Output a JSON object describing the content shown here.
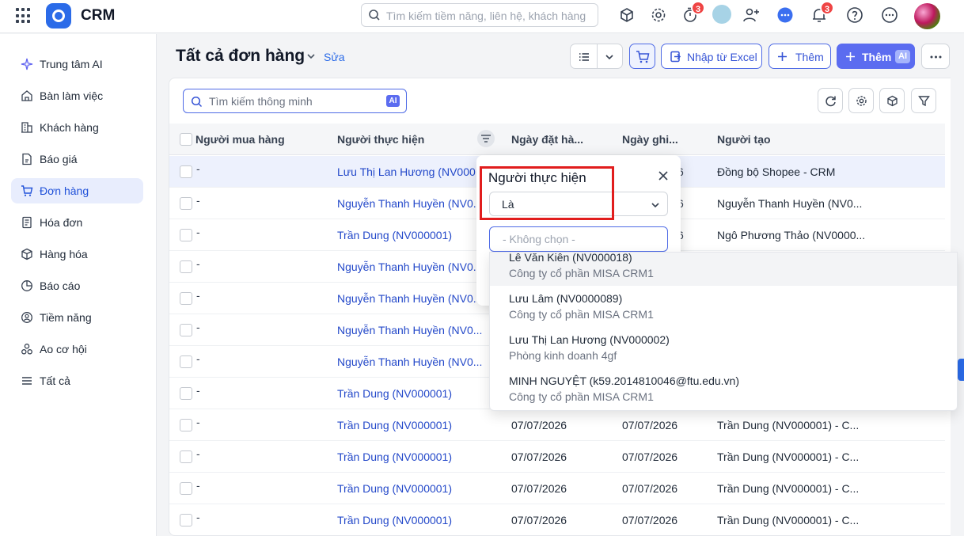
{
  "app": {
    "name": "CRM"
  },
  "topbar": {
    "search_placeholder": "Tìm kiếm tiềm năng, liên hệ, khách hàng",
    "timer_badge": "3",
    "notif_badge": "3"
  },
  "sidebar": {
    "items": [
      {
        "label": "Trung tâm AI",
        "icon": "sparkle-icon"
      },
      {
        "label": "Bàn làm việc",
        "icon": "home-icon"
      },
      {
        "label": "Khách hàng",
        "icon": "building-icon"
      },
      {
        "label": "Báo giá",
        "icon": "quote-doc-icon"
      },
      {
        "label": "Đơn hàng",
        "icon": "cart-icon",
        "active": true
      },
      {
        "label": "Hóa đơn",
        "icon": "invoice-icon"
      },
      {
        "label": "Hàng hóa",
        "icon": "box-icon"
      },
      {
        "label": "Báo cáo",
        "icon": "pie-chart-icon"
      },
      {
        "label": "Tiềm năng",
        "icon": "lead-icon"
      },
      {
        "label": "Ao cơ hội",
        "icon": "opportunity-icon"
      },
      {
        "label": "Tất cả",
        "icon": "menu-icon"
      }
    ]
  },
  "header": {
    "title": "Tất cả đơn hàng",
    "edit": "Sửa",
    "import_label": "Nhập từ Excel",
    "add_label": "Thêm",
    "add_ai_label": "Thêm",
    "ai_tag": "AI"
  },
  "toolbar": {
    "smart_search_placeholder": "Tìm kiếm thông minh",
    "ai_tag": "AI"
  },
  "table": {
    "columns": [
      "Người mua hàng",
      "Người thực hiện",
      "Ngày đặt hà...",
      "Ngày ghi...",
      "Người tạo"
    ],
    "rows": [
      {
        "buyer": "-",
        "performer": "Lưu Thị Lan Hương (NV000...",
        "order_date": "",
        "record_date": "",
        "creator": "Đồng bộ Shopee - CRM",
        "selected": true
      },
      {
        "buyer": "-",
        "performer": "Nguyễn Thanh Huyền (NV0...",
        "order_date": "",
        "record_date": "",
        "creator": "Nguyễn Thanh Huyền (NV0..."
      },
      {
        "buyer": "-",
        "performer": "Trần Dung (NV000001)",
        "order_date": "",
        "record_date": "",
        "creator": "Ngô Phương Thảo (NV0000..."
      },
      {
        "buyer": "-",
        "performer": "Nguyễn Thanh Huyền (NV0...",
        "order_date": "",
        "record_date": "",
        "creator": ""
      },
      {
        "buyer": "-",
        "performer": "Nguyễn Thanh Huyền (NV0...",
        "order_date": "",
        "record_date": "",
        "creator": ""
      },
      {
        "buyer": "-",
        "performer": "Nguyễn Thanh Huyền (NV0...",
        "order_date": "",
        "record_date": "",
        "creator": ""
      },
      {
        "buyer": "-",
        "performer": "Nguyễn Thanh Huyền (NV0...",
        "order_date": "",
        "record_date": "",
        "creator": ""
      },
      {
        "buyer": "-",
        "performer": "Trần Dung (NV000001)",
        "order_date": "",
        "record_date": "",
        "creator": ""
      },
      {
        "buyer": "-",
        "performer": "Trần Dung (NV000001)",
        "order_date": "07/07/2026",
        "record_date": "07/07/2026",
        "creator": "Trần Dung (NV000001) - C..."
      },
      {
        "buyer": "-",
        "performer": "Trần Dung (NV000001)",
        "order_date": "07/07/2026",
        "record_date": "07/07/2026",
        "creator": "Trần Dung (NV000001) - C..."
      },
      {
        "buyer": "-",
        "performer": "Trần Dung (NV000001)",
        "order_date": "07/07/2026",
        "record_date": "07/07/2026",
        "creator": "Trần Dung (NV000001) - C..."
      },
      {
        "buyer": "-",
        "performer": "Trần Dung (NV000001)",
        "order_date": "07/07/2026",
        "record_date": "07/07/2026",
        "creator": "Trần Dung (NV000001) - C..."
      }
    ],
    "partial_date_suffix": "6"
  },
  "filter_popover": {
    "title": "Người thực hiện",
    "operator": "Là",
    "combo_placeholder": "- Không chọn -",
    "options": [
      {
        "name": "Lê Văn Kiên (NV000018)",
        "sub": "Công ty cổ phần MISA CRM1"
      },
      {
        "name": "Lưu Lâm (NV0000089)",
        "sub": "Công ty cổ phần MISA CRM1"
      },
      {
        "name": "Lưu Thị Lan Hương (NV000002)",
        "sub": "Phòng kinh doanh 4gf"
      },
      {
        "name": "MINH NGUYỆT (k59.2014810046@ftu.edu.vn)",
        "sub": "Công ty cổ phần MISA CRM1"
      }
    ]
  }
}
